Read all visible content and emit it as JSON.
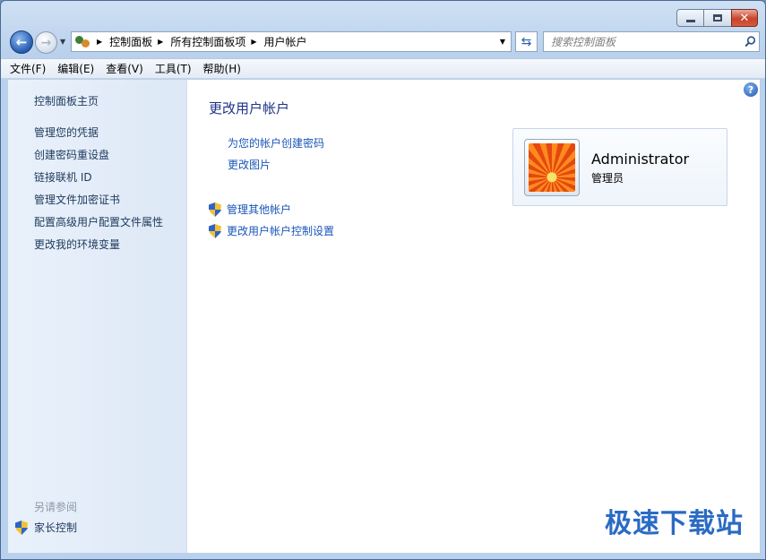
{
  "window": {
    "caption": {
      "minimize": "",
      "maximize": "",
      "close": "✕"
    }
  },
  "nav": {
    "breadcrumbs": [
      "控制面板",
      "所有控制面板项",
      "用户帐户"
    ],
    "search_placeholder": "搜索控制面板"
  },
  "menu": [
    "文件(F)",
    "编辑(E)",
    "查看(V)",
    "工具(T)",
    "帮助(H)"
  ],
  "sidebar": {
    "home": "控制面板主页",
    "links": [
      "管理您的凭据",
      "创建密码重设盘",
      "链接联机 ID",
      "管理文件加密证书",
      "配置高级用户配置文件属性",
      "更改我的环境变量"
    ],
    "see_also_title": "另请参阅",
    "see_also": [
      "家长控制"
    ]
  },
  "main": {
    "title": "更改用户帐户",
    "tasks": [
      "为您的帐户创建密码",
      "更改图片"
    ],
    "shield_tasks": [
      "管理其他帐户",
      "更改用户帐户控制设置"
    ],
    "help": "?"
  },
  "user": {
    "name": "Administrator",
    "role": "管理员"
  },
  "watermark": "极速下载站",
  "colors": {
    "link": "#1a56b8",
    "title": "#1e3287",
    "sidebar_bg": "#e9f1fb"
  }
}
